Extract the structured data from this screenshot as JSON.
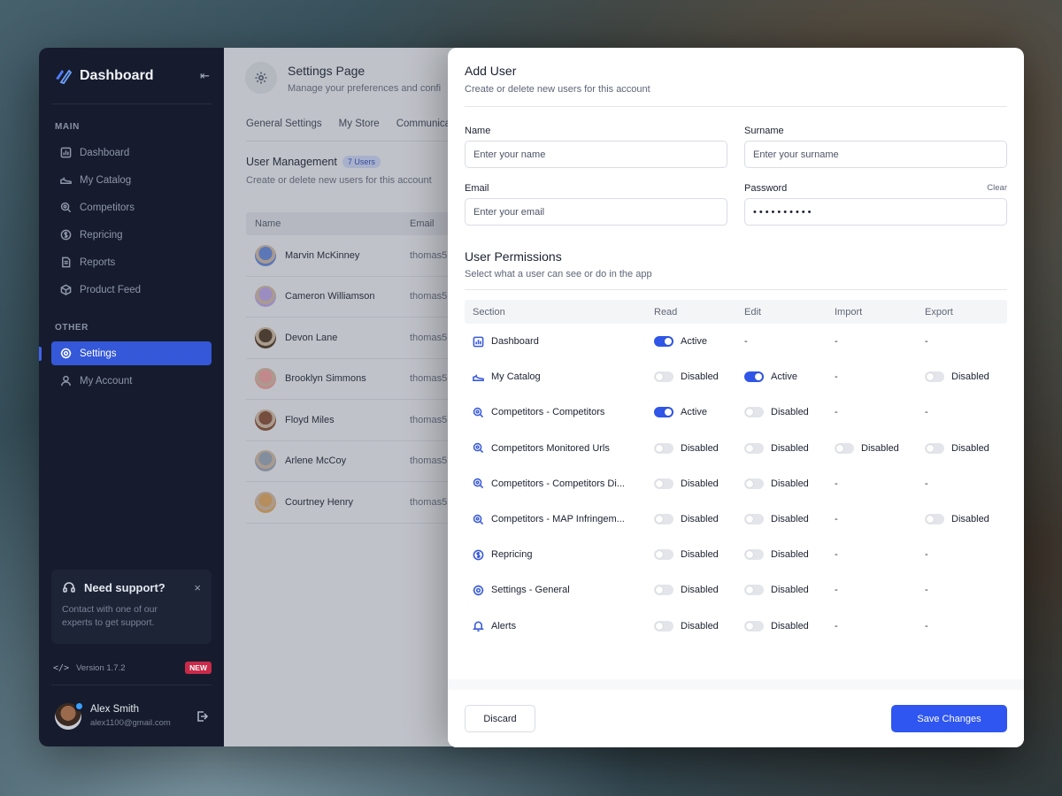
{
  "sidebar": {
    "brand": "Dashboard",
    "main_label": "MAIN",
    "other_label": "OTHER",
    "main_items": [
      {
        "label": "Dashboard",
        "icon": "chart-icon"
      },
      {
        "label": "My Catalog",
        "icon": "shoe-icon"
      },
      {
        "label": "Competitors",
        "icon": "search-icon"
      },
      {
        "label": "Repricing",
        "icon": "dollar-icon"
      },
      {
        "label": "Reports",
        "icon": "document-icon"
      },
      {
        "label": "Product Feed",
        "icon": "box-icon"
      }
    ],
    "other_items": [
      {
        "label": "Settings",
        "icon": "gear-icon",
        "active": true
      },
      {
        "label": "My Account",
        "icon": "user-icon"
      }
    ],
    "support": {
      "title": "Need support?",
      "text": "Contact with one of our experts to get support.",
      "close": "×"
    },
    "version": "Version 1.7.2",
    "version_badge": "NEW",
    "user": {
      "name": "Alex Smith",
      "email": "alex1100@gmail.com"
    }
  },
  "settings": {
    "title": "Settings Page",
    "subtitle": "Manage your preferences and confi",
    "tabs": [
      "General Settings",
      "My Store",
      "Communica"
    ],
    "um_title": "User Management",
    "um_badge": "7 Users",
    "um_subtitle": "Create or delete new users for this account",
    "col_name": "Name",
    "col_email": "Email",
    "users": [
      {
        "name": "Marvin McKinney",
        "email": "thomas5",
        "color": "#6b8bd6"
      },
      {
        "name": "Cameron Williamson",
        "email": "thomas5",
        "color": "#b9a6e3"
      },
      {
        "name": "Devon Lane",
        "email": "thomas5",
        "color": "#5a4636"
      },
      {
        "name": "Brooklyn Simmons",
        "email": "thomas5",
        "color": "#e7a2a2"
      },
      {
        "name": "Floyd Miles",
        "email": "thomas5",
        "color": "#8a5a45"
      },
      {
        "name": "Arlene McCoy",
        "email": "thomas5",
        "color": "#9aa7b8"
      },
      {
        "name": "Courtney Henry",
        "email": "thomas5",
        "color": "#d9a86a"
      }
    ]
  },
  "modal": {
    "title": "Add User",
    "subtitle": "Create or delete new users for this account",
    "name_label": "Name",
    "name_placeholder": "Enter your name",
    "surname_label": "Surname",
    "surname_placeholder": "Enter your surname",
    "email_label": "Email",
    "email_placeholder": "Enter your email",
    "password_label": "Password",
    "password_clear": "Clear",
    "password_value": "••••••••••",
    "perm_title": "User Permissions",
    "perm_subtitle": "Select what a user can see or do in the app",
    "columns": [
      "Section",
      "Read",
      "Edit",
      "Import",
      "Export"
    ],
    "rows": [
      {
        "section": "Dashboard",
        "icon": "chart-icon",
        "read": "on",
        "edit": "-",
        "import": "-",
        "export": "-"
      },
      {
        "section": "My Catalog",
        "icon": "shoe-icon",
        "read": "off",
        "edit": "on",
        "import": "-",
        "export": "off"
      },
      {
        "section": "Competitors - Competitors",
        "icon": "search-icon",
        "read": "on",
        "edit": "off",
        "import": "-",
        "export": "-"
      },
      {
        "section": "Competitors Monitored Urls",
        "icon": "search-icon",
        "read": "off",
        "edit": "off",
        "import": "off",
        "export": "off"
      },
      {
        "section": "Competitors - Competitors Di...",
        "icon": "search-icon",
        "read": "off",
        "edit": "off",
        "import": "-",
        "export": "-"
      },
      {
        "section": "Competitors - MAP Infringem...",
        "icon": "search-icon",
        "read": "off",
        "edit": "off",
        "import": "-",
        "export": "off"
      },
      {
        "section": "Repricing",
        "icon": "dollar-icon",
        "read": "off",
        "edit": "off",
        "import": "-",
        "export": "-"
      },
      {
        "section": "Settings - General",
        "icon": "gear-icon",
        "read": "off",
        "edit": "off",
        "import": "-",
        "export": "-"
      },
      {
        "section": "Alerts",
        "icon": "bell-icon",
        "read": "off",
        "edit": "off",
        "import": "-",
        "export": "-"
      }
    ],
    "active_label": "Active",
    "disabled_label": "Disabled",
    "discard_label": "Discard",
    "save_label": "Save Changes"
  }
}
